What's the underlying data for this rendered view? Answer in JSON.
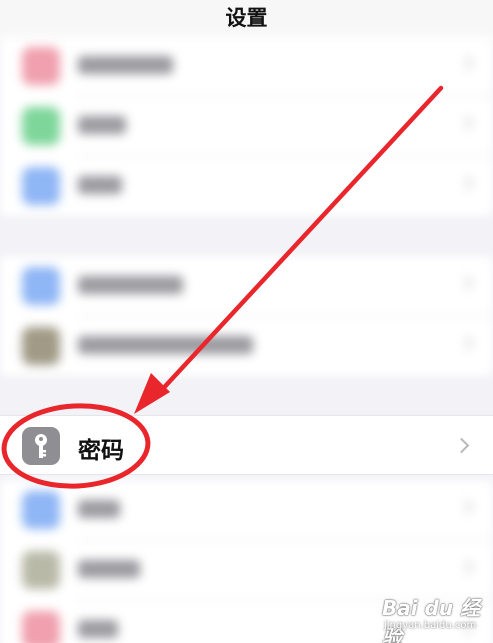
{
  "header": {
    "title": "设置"
  },
  "password_row": {
    "label": "密码"
  },
  "watermark": {
    "brand": "Bai du 经验",
    "sub": "jingyan.baidu.com"
  },
  "colors": {
    "accent_red": "#e8262b",
    "icon_pink": "#f0a0ae",
    "icon_green": "#7ed69a",
    "icon_blue": "#8fb6f5",
    "icon_olive": "#a09a86",
    "icon_gray": "#8e8e93"
  },
  "icons": [
    "key-icon",
    "chevron-right-icon"
  ]
}
